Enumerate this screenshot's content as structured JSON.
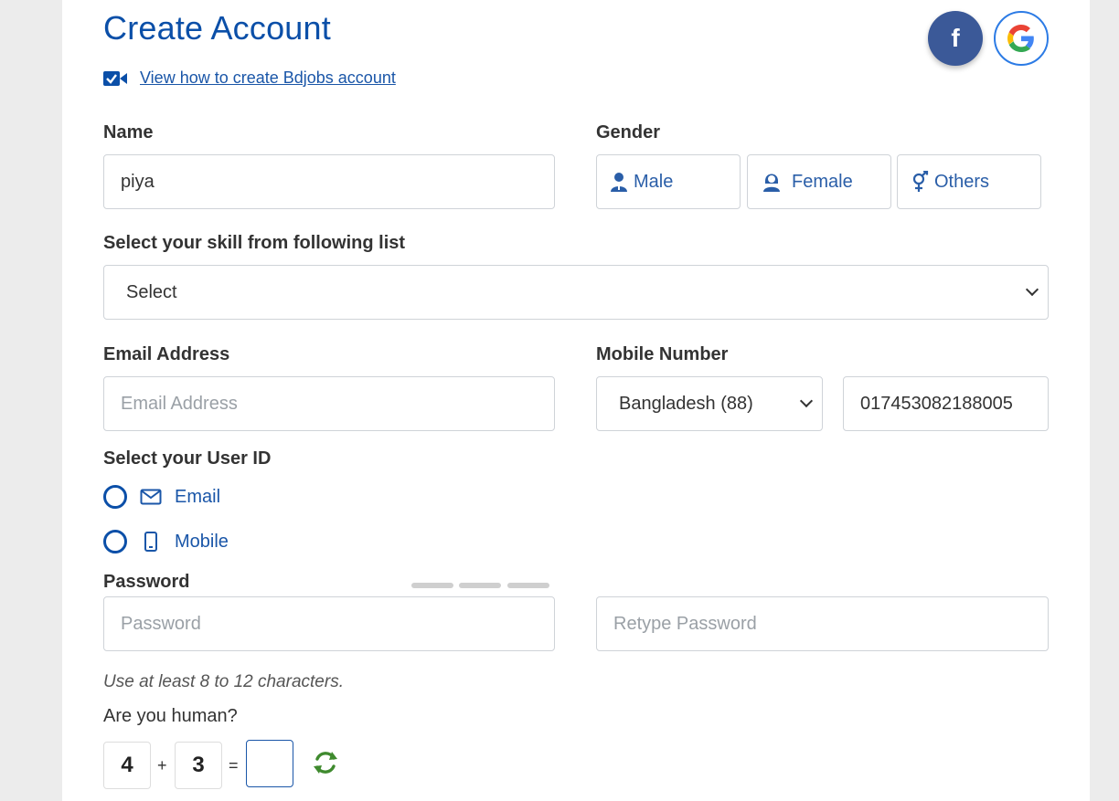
{
  "header": {
    "title": "Create Account",
    "howto_link": "View how to create Bdjobs account",
    "facebook_glyph": "f"
  },
  "name": {
    "label": "Name",
    "value": "piya"
  },
  "gender": {
    "label": "Gender",
    "options": [
      {
        "label": "Male",
        "icon": "male-user-icon"
      },
      {
        "label": "Female",
        "icon": "female-user-icon"
      },
      {
        "label": "Others",
        "icon": "gender-symbol-icon"
      }
    ]
  },
  "skill": {
    "label": "Select your skill from following list",
    "selected": "Select"
  },
  "email": {
    "label": "Email Address",
    "placeholder": "Email Address"
  },
  "mobile": {
    "label": "Mobile Number",
    "country": "Bangladesh (88)",
    "value": "01745308218800​5"
  },
  "user_id": {
    "label": "Select your User ID",
    "options": [
      {
        "label": "Email",
        "icon": "envelope-icon"
      },
      {
        "label": "Mobile",
        "icon": "phone-icon"
      }
    ]
  },
  "password": {
    "label": "Password",
    "placeholder": "Password",
    "retype_placeholder": "Retype Password",
    "hint": "Use at least 8 to 12 characters."
  },
  "captcha": {
    "question": "Are you human?",
    "a": "4",
    "op": "+",
    "b": "3",
    "eq": "=",
    "answer": ""
  },
  "colors": {
    "primary": "#0b4fa8",
    "facebook": "#3b5998",
    "refresh": "#3f8a2e",
    "background": "#ececec"
  }
}
